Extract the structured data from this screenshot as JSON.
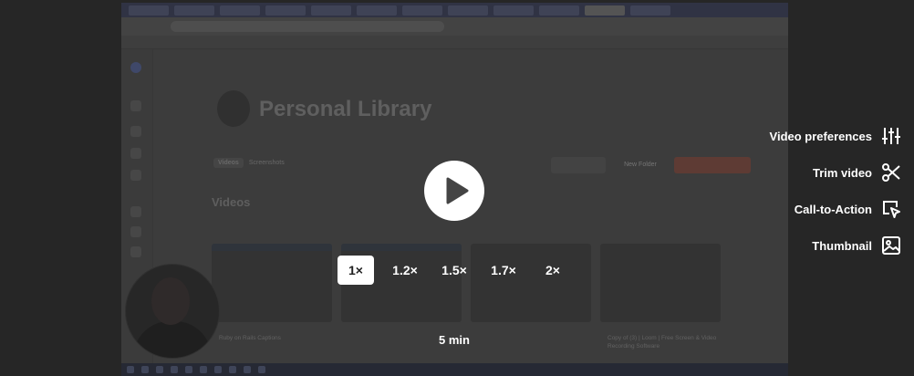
{
  "player": {
    "speeds": [
      "1×",
      "1.2×",
      "1.5×",
      "1.7×",
      "2×"
    ],
    "selected_speed": "1×",
    "duration": "5 min",
    "actions": [
      {
        "label": "Video preferences",
        "icon": "sliders-icon"
      },
      {
        "label": "Trim video",
        "icon": "scissors-icon"
      },
      {
        "label": "Call-to-Action",
        "icon": "cursor-click-icon"
      },
      {
        "label": "Thumbnail",
        "icon": "image-icon"
      }
    ]
  },
  "recording": {
    "page_title": "Personal Library",
    "tabs": [
      "Videos",
      "Screenshots"
    ],
    "new_folder": "New Folder",
    "section": "Videos",
    "card_titles": [
      "Ruby on Rails Captions",
      "Copy of (3) | Loom | Free Screen & Video Recording Software"
    ]
  }
}
